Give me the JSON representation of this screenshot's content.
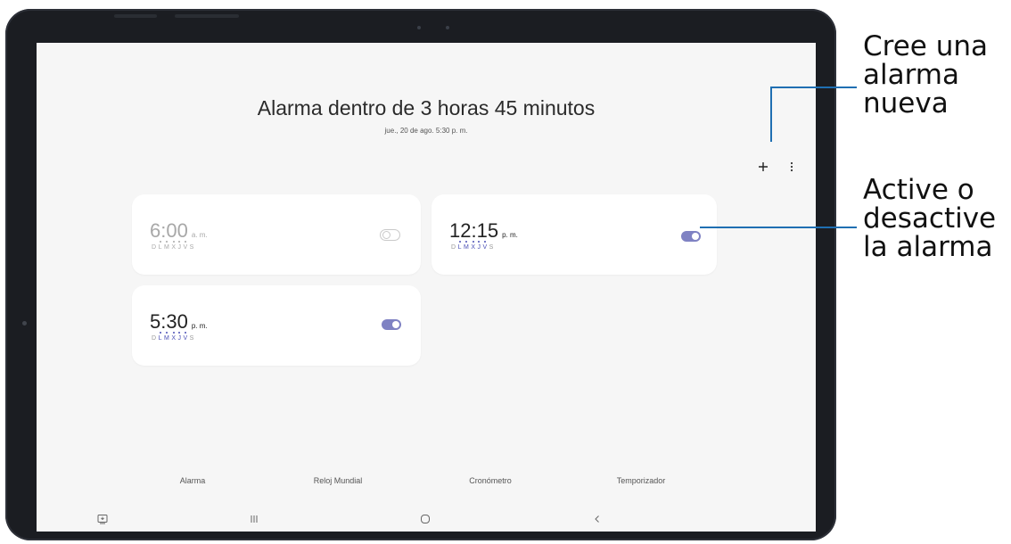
{
  "header": {
    "title": "Alarma dentro de 3 horas 45 minutos",
    "subtitle": "jue., 20 de ago. 5:30 p. m."
  },
  "top_actions": {
    "add_icon": "plus-icon",
    "more_icon": "more-vertical-icon"
  },
  "alarms": [
    {
      "time": "6:00",
      "ampm": "a. m.",
      "enabled": false,
      "days": [
        "D",
        "L",
        "M",
        "X",
        "J",
        "V",
        "S"
      ],
      "active_days": [
        false,
        true,
        true,
        true,
        true,
        true,
        false
      ]
    },
    {
      "time": "12:15",
      "ampm": "p. m.",
      "enabled": true,
      "days": [
        "D",
        "L",
        "M",
        "X",
        "J",
        "V",
        "S"
      ],
      "active_days": [
        false,
        true,
        true,
        true,
        true,
        true,
        false
      ]
    },
    {
      "time": "5:30",
      "ampm": "p. m.",
      "enabled": true,
      "days": [
        "D",
        "L",
        "M",
        "X",
        "J",
        "V",
        "S"
      ],
      "active_days": [
        false,
        true,
        true,
        true,
        true,
        true,
        false
      ]
    }
  ],
  "tabs": [
    {
      "label": "Alarma",
      "active": true
    },
    {
      "label": "Reloj Mundial",
      "active": false
    },
    {
      "label": "Cronómetro",
      "active": false
    },
    {
      "label": "Temporizador",
      "active": false
    }
  ],
  "nav_bar": {
    "screenshot_icon": "screenshot-icon",
    "recents_icon": "recents-icon",
    "home_icon": "home-icon",
    "back_icon": "back-icon"
  },
  "callouts": {
    "new_alarm": [
      "Cree una",
      "alarma",
      "nueva"
    ],
    "toggle_alarm": [
      "Active o",
      "desactive",
      "la alarma"
    ]
  },
  "colors": {
    "accent": "#3a3fa0",
    "toggle_on": "#7f82c3",
    "active_day": "#4a4fb5",
    "disabled_text": "#a8a8a8",
    "callout_line": "#1f6fb2"
  }
}
